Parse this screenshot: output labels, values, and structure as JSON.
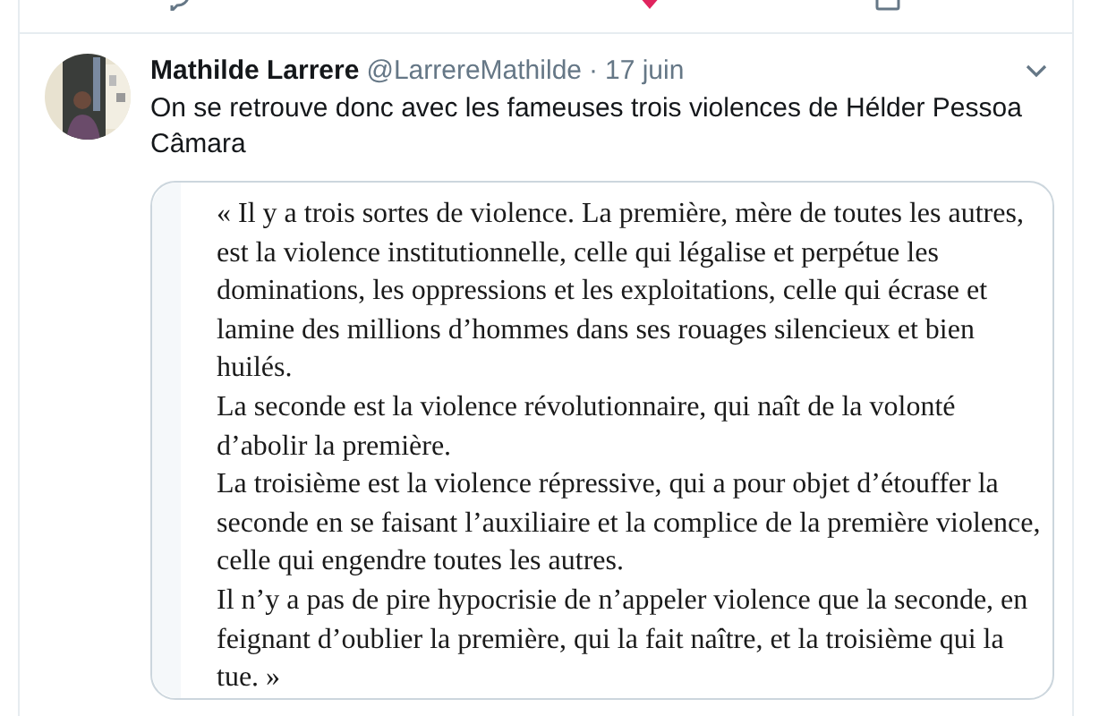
{
  "tweet": {
    "author": "Mathilde Larrere",
    "handle": "@LarrereMathilde",
    "separator": "·",
    "date": "17 juin",
    "text": "On se retrouve donc avec les fameuses trois violences de Hélder Pessoa Câmara",
    "quote": [
      "« Il y a trois sortes de violence. La première, mère de toutes les autres, est la violence institutionnelle, celle qui légalise et perpétue les dominations, les oppressions et les exploitations, celle qui écrase et lamine des millions d’hommes dans ses rouages silencieux et bien huilés.",
      "La seconde est la violence révolutionnaire, qui naît de la volonté d’abolir la première.",
      "La troisième est la violence répressive, qui a pour objet d’étouffer la seconde en se faisant l’auxiliaire et la complice de la première violence, celle qui engendre toutes les autres.",
      "Il n’y a pas de pire hypocrisie de n’appeler violence que la seconde, en feignant d’oublier la première, qui la fait naître, et la troisième qui la tue. »"
    ]
  }
}
